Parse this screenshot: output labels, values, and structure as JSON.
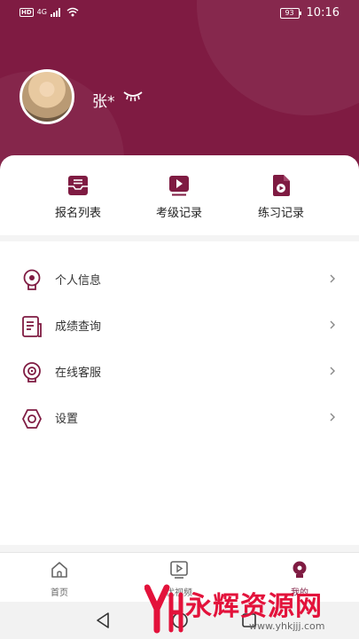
{
  "status_bar": {
    "badge": "HD",
    "network": "4G",
    "battery": "93",
    "time": "10:16"
  },
  "profile": {
    "name": "张*",
    "visibility_icon": "eye-closed-icon"
  },
  "quick_actions": [
    {
      "label": "报名列表",
      "icon": "registration-list-icon"
    },
    {
      "label": "考级记录",
      "icon": "exam-record-icon"
    },
    {
      "label": "练习记录",
      "icon": "practice-record-icon"
    }
  ],
  "menu": [
    {
      "label": "个人信息",
      "icon": "personal-info-icon"
    },
    {
      "label": "成绩查询",
      "icon": "score-query-icon"
    },
    {
      "label": "在线客服",
      "icon": "customer-service-icon"
    },
    {
      "label": "设置",
      "icon": "settings-icon"
    }
  ],
  "tabs": [
    {
      "label": "首页",
      "icon": "home-icon"
    },
    {
      "label": "优视频",
      "icon": "video-icon"
    },
    {
      "label": "我的",
      "icon": "profile-icon",
      "active": true
    }
  ],
  "watermark": {
    "title": "永辉资源网",
    "url": "www.yhkjjj.com"
  },
  "colors": {
    "brand": "#7f1b42",
    "watermark": "#e3123b"
  }
}
